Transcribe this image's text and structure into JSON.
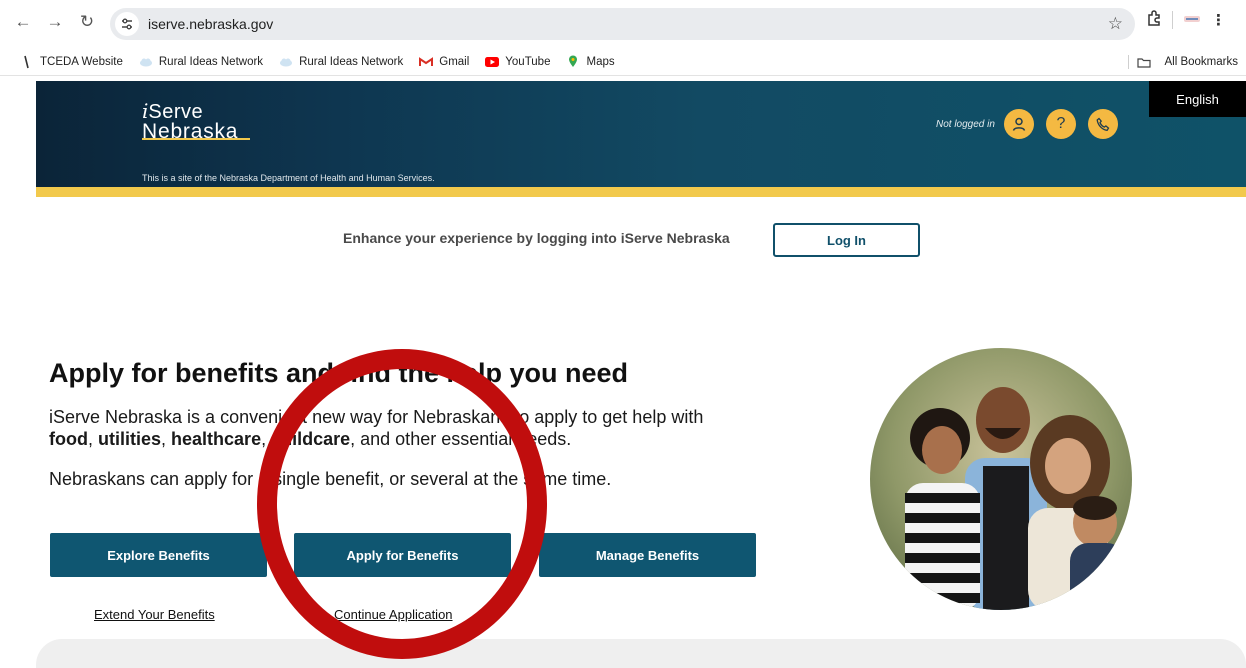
{
  "browser": {
    "url": "iserve.nebraska.gov",
    "bookmarks": [
      {
        "label": "TCEDA Website",
        "icon": "pin-icon"
      },
      {
        "label": "Rural Ideas Network",
        "icon": "cloud-icon"
      },
      {
        "label": "Rural Ideas Network",
        "icon": "cloud-icon"
      },
      {
        "label": "Gmail",
        "icon": "gmail-icon"
      },
      {
        "label": "YouTube",
        "icon": "youtube-icon"
      },
      {
        "label": "Maps",
        "icon": "maps-icon"
      }
    ],
    "all_bookmarks": "All Bookmarks"
  },
  "header": {
    "logo_i": "i",
    "logo_serve": "Serve",
    "logo_state": "Nebraska",
    "tagline": "This is a site of the Nebraska Department of Health and Human Services.",
    "login_status": "Not logged in",
    "language": "English"
  },
  "login_prompt": {
    "text": "Enhance your experience by logging into iServe Nebraska",
    "button": "Log In"
  },
  "hero": {
    "title": "Apply for benefits and find the help you need",
    "intro": "iServe Nebraska is a convenient new way for Nebraskans to apply to get help with",
    "intro_food": "food",
    "intro_utilities": "utilities",
    "intro_healthcare": "healthcare",
    "intro_childcare": "childcare",
    "intro_tail": ", and other essential needs.",
    "line2": "Nebraskans can apply for a single benefit, or several at the same time."
  },
  "actions": {
    "explore": "Explore Benefits",
    "apply": "Apply for Benefits",
    "manage": "Manage Benefits",
    "extend": "Extend Your Benefits",
    "continue": "Continue Application"
  },
  "colors": {
    "header_teal": "#0f5268",
    "accent_gold": "#f2c94c",
    "button_teal": "#0f5671",
    "annotation_red": "#c00d0d"
  }
}
